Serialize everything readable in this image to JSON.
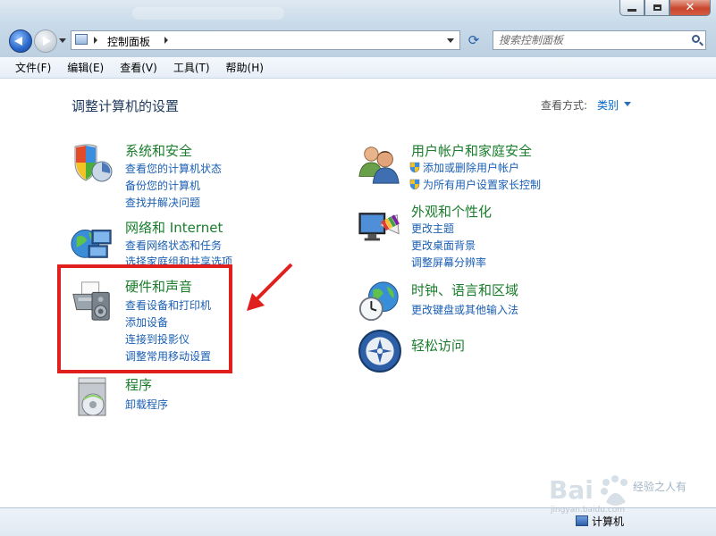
{
  "window": {
    "address": {
      "location": "控制面板"
    },
    "search": {
      "placeholder": "搜索控制面板"
    }
  },
  "menu": [
    "文件(F)",
    "编辑(E)",
    "查看(V)",
    "工具(T)",
    "帮助(H)"
  ],
  "header": {
    "title": "调整计算机的设置",
    "view_by_label": "查看方式:",
    "view_by_value": "类别"
  },
  "categories": {
    "system_security": {
      "title": "系统和安全",
      "icon": "shield-icon",
      "links": [
        "查看您的计算机状态",
        "备份您的计算机",
        "查找并解决问题"
      ]
    },
    "network": {
      "title": "网络和 Internet",
      "icon": "network-globe-icon",
      "links": [
        "查看网络状态和任务",
        "选择家庭组和共享选项"
      ]
    },
    "hardware_sound": {
      "title": "硬件和声音",
      "icon": "printer-speaker-icon",
      "links": [
        "查看设备和打印机",
        "添加设备",
        "连接到投影仪",
        "调整常用移动设置"
      ]
    },
    "programs": {
      "title": "程序",
      "icon": "programs-disc-icon",
      "links": [
        "卸载程序"
      ]
    },
    "user_accounts": {
      "title": "用户帐户和家庭安全",
      "icon": "users-icon",
      "links": [
        "添加或删除用户帐户",
        "为所有用户设置家长控制"
      ]
    },
    "appearance": {
      "title": "外观和个性化",
      "icon": "monitor-palette-icon",
      "links": [
        "更改主题",
        "更改桌面背景",
        "调整屏幕分辨率"
      ]
    },
    "clock_region": {
      "title": "时钟、语言和区域",
      "icon": "clock-globe-icon",
      "links": [
        "更改键盘或其他输入法"
      ]
    },
    "ease_access": {
      "title": "轻松访问",
      "icon": "ease-of-access-icon",
      "links": []
    }
  },
  "status": {
    "text": "计算机"
  },
  "watermark": {
    "text": "经验之人有",
    "sub": "jingyan.baidu.com"
  },
  "colors": {
    "category_title": "#1a7d2c",
    "link": "#1a5fb4",
    "annotation": "#e0201c"
  }
}
